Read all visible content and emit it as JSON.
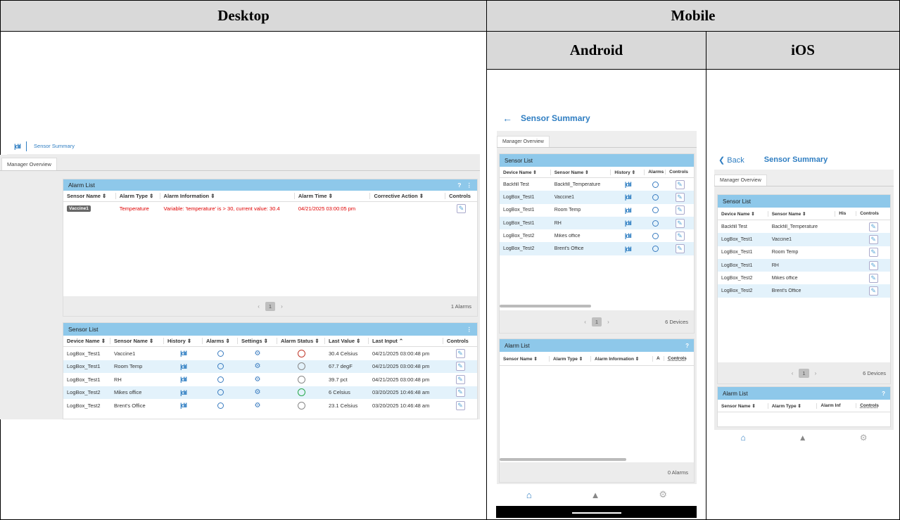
{
  "headers": {
    "desktop": "Desktop",
    "mobile": "Mobile",
    "android": "Android",
    "ios": "iOS"
  },
  "desktop": {
    "app_title": "Sensor Summary",
    "tab": "Manager Overview",
    "alarm_list": {
      "title": "Alarm List",
      "help": "?",
      "menu": "⋮",
      "columns": [
        "Sensor Name ⇕",
        "Alarm Type ⇕",
        "Alarm Information ⇕",
        "Alarm Time ⇕",
        "Corrective Action ⇕",
        "Controls"
      ],
      "rows": [
        {
          "sensor": "Vaccine1",
          "type": "Temperature",
          "info": "Variable: 'temperature' is > 30, current value: 30.4",
          "time": "04/21/2025 03:00:05 pm"
        }
      ],
      "page": "1",
      "count": "1 Alarms"
    },
    "sensor_list": {
      "title": "Sensor List",
      "menu": "⋮",
      "columns": [
        "Device Name ⇕",
        "Sensor Name ⇕",
        "History ⇕",
        "Alarms ⇕",
        "Settings ⇕",
        "Alarm Status ⇕",
        "Last Value ⇕",
        "Last Input ⌃",
        "Controls"
      ],
      "rows": [
        {
          "device": "LogBox_Test1",
          "sensor": "Vaccine1",
          "status_color": "#c0392b",
          "value": "30.4 Celsius",
          "input": "04/21/2025 03:00:48 pm"
        },
        {
          "device": "LogBox_Test1",
          "sensor": "Room Temp",
          "status_color": "#888888",
          "value": "67.7 degF",
          "input": "04/21/2025 03:00:48 pm"
        },
        {
          "device": "LogBox_Test1",
          "sensor": "RH",
          "status_color": "#888888",
          "value": "39.7 pct",
          "input": "04/21/2025 03:00:48 pm"
        },
        {
          "device": "LogBox_Test2",
          "sensor": "Mikes office",
          "status_color": "#27a84a",
          "value": "6 Celsius",
          "input": "03/20/2025 10:46:48 am"
        },
        {
          "device": "LogBox_Test2",
          "sensor": "Brent's Office",
          "status_color": "#888888",
          "value": "23.1 Celsius",
          "input": "03/20/2025 10:46:48 am"
        }
      ]
    }
  },
  "android": {
    "back": "←",
    "title": "Sensor Summary",
    "tab": "Manager Overview",
    "sensor_list": {
      "title": "Sensor List",
      "columns": [
        "Device Name ⇕",
        "Sensor Name ⇕",
        "History ⇕",
        "Alarms",
        "Controls"
      ],
      "rows": [
        {
          "device": "Backfill Test",
          "sensor": "Backfill_Temperature"
        },
        {
          "device": "LogBox_Test1",
          "sensor": "Vaccine1"
        },
        {
          "device": "LogBox_Test1",
          "sensor": "Room Temp"
        },
        {
          "device": "LogBox_Test1",
          "sensor": "RH"
        },
        {
          "device": "LogBox_Test2",
          "sensor": "Mikes office"
        },
        {
          "device": "LogBox_Test2",
          "sensor": "Brent's Office"
        }
      ],
      "page": "1",
      "count": "6 Devices"
    },
    "alarm_list": {
      "title": "Alarm List",
      "help": "?",
      "columns": [
        "Sensor Name ⇕",
        "Alarm Type ⇕",
        "Alarm Information ⇕",
        "A",
        "Controls"
      ],
      "count": "0 Alarms"
    }
  },
  "ios": {
    "back": "Back",
    "title": "Sensor Summary",
    "tab": "Manager Overview",
    "sensor_list": {
      "title": "Sensor List",
      "columns": [
        "Device Name ⇕",
        "Sensor Name ⇕",
        "His",
        "Controls"
      ],
      "rows": [
        {
          "device": "Backfill Test",
          "sensor": "Backfill_Temperature"
        },
        {
          "device": "LogBox_Test1",
          "sensor": "Vaccine1"
        },
        {
          "device": "LogBox_Test1",
          "sensor": "Room Temp"
        },
        {
          "device": "LogBox_Test1",
          "sensor": "RH"
        },
        {
          "device": "LogBox_Test2",
          "sensor": "Mikes office"
        },
        {
          "device": "LogBox_Test2",
          "sensor": "Brent's Office"
        }
      ],
      "page": "1",
      "count": "6 Devices"
    },
    "alarm_list": {
      "title": "Alarm List",
      "help": "?",
      "columns": [
        "Sensor Name ⇕",
        "Alarm Type ⇕",
        "Alarm Inf",
        "Controls"
      ]
    }
  },
  "colors": {
    "accent": "#2f7ec2",
    "panel_head": "#8ec8ea",
    "row_alt": "#e3f2fb",
    "alarm_red": "#e00000"
  }
}
